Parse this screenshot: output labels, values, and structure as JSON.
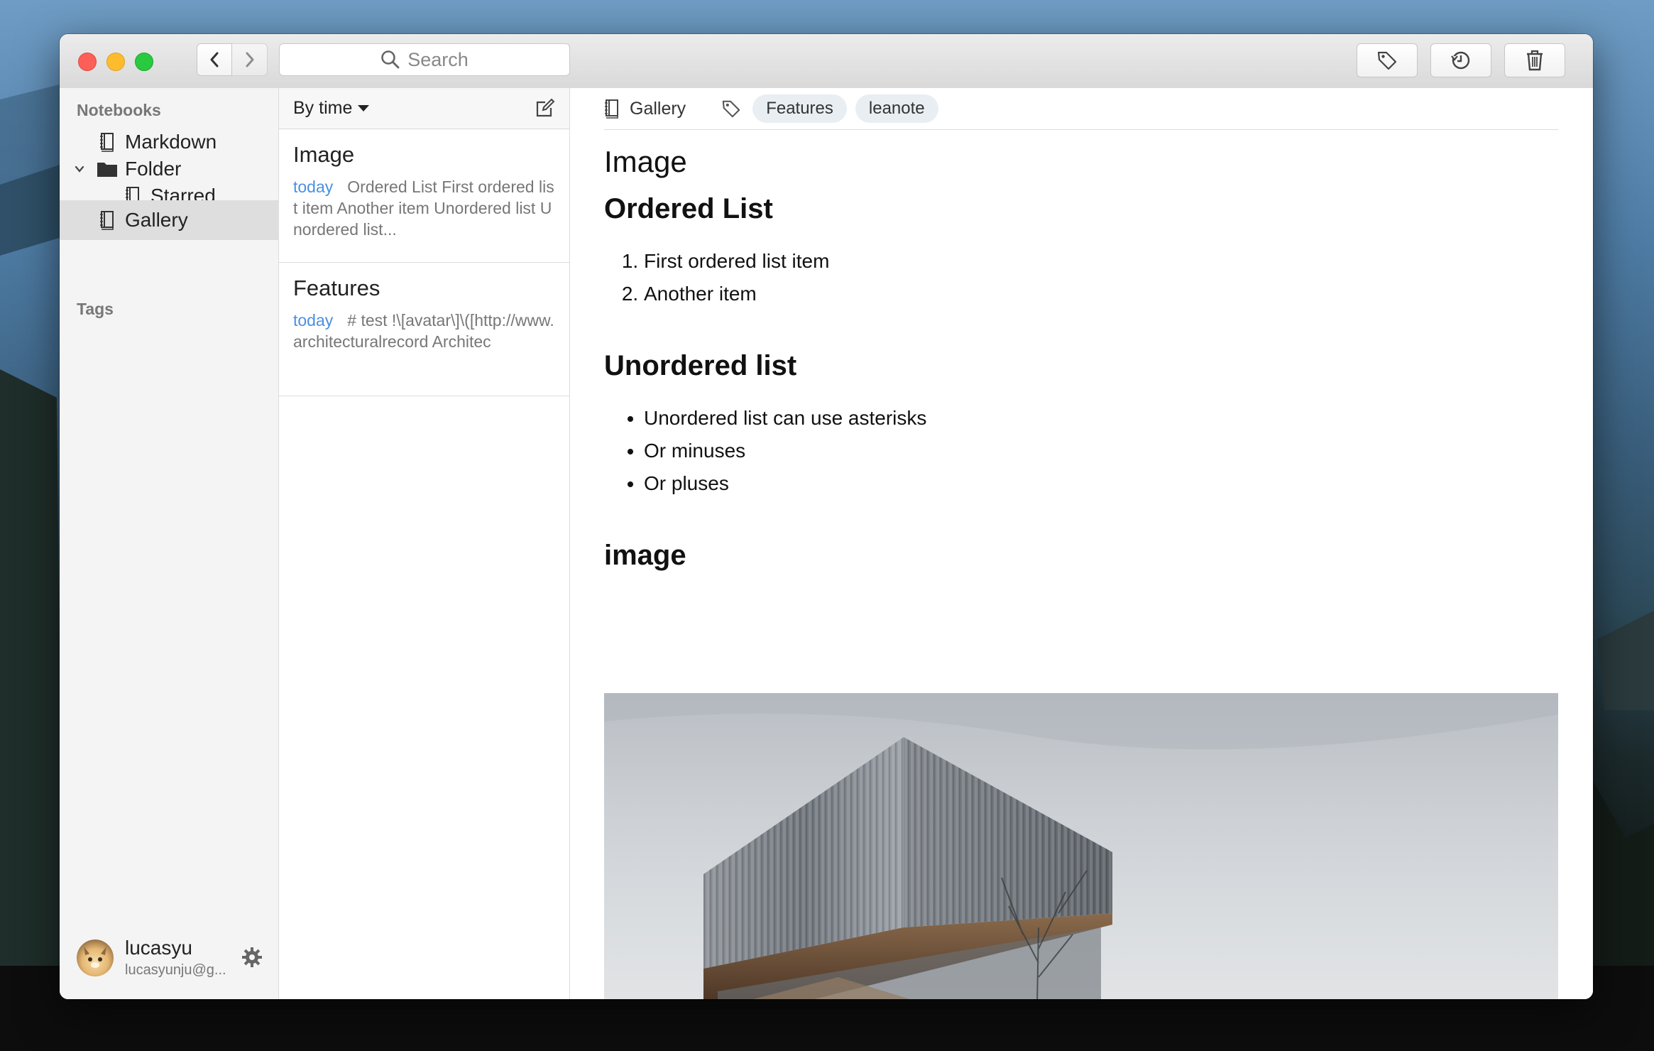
{
  "titlebar": {
    "search_placeholder": "Search"
  },
  "sidebar": {
    "notebooks_heading": "Notebooks",
    "items": [
      {
        "label": "Markdown"
      },
      {
        "label": "Folder"
      },
      {
        "label": "Starred"
      },
      {
        "label": "Gallery"
      }
    ],
    "tags_heading": "Tags",
    "user": {
      "name": "lucasyu",
      "email": "lucasyunju@g..."
    }
  },
  "notelist": {
    "sort_label": "By time",
    "notes": [
      {
        "title": "Image",
        "date": "today",
        "snippet": "Ordered List First ordered list item Another item Unordered list Unordered list..."
      },
      {
        "title": "Features",
        "date": "today",
        "snippet": "# test !\\[avatar\\]\\([http://www.architecturalrecord Architec"
      }
    ]
  },
  "editor": {
    "notebook": "Gallery",
    "tags": [
      "Features",
      "leanote"
    ],
    "title": "Image",
    "h_ordered": "Ordered List",
    "ordered_items": [
      "First ordered list item",
      "Another item"
    ],
    "h_unordered": "Unordered list",
    "unordered_items": [
      "Unordered list can use asterisks",
      "Or minuses",
      "Or pluses"
    ],
    "h_image": "image"
  },
  "colors": {
    "accent_date": "#4a90e2",
    "close": "#fc5f57",
    "minimize": "#fdbc2e",
    "maximize": "#29c940",
    "tag_bg": "#e8eef2",
    "active_item_bg": "#dedede"
  }
}
